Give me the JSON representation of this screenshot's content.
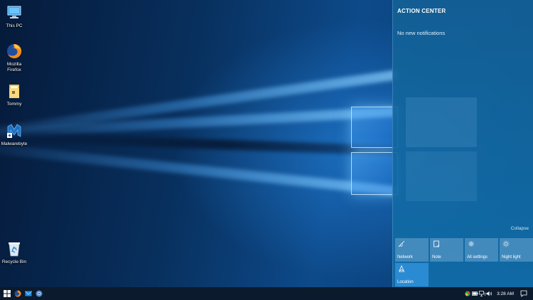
{
  "desktop": {
    "icons": [
      {
        "label": "This PC",
        "icon": "computer-icon"
      },
      {
        "label": "Mozilla Firefox",
        "icon": "firefox-icon"
      },
      {
        "label": "Tommy",
        "icon": "folder-icon"
      },
      {
        "label": "Malwarebyte",
        "icon": "malwarebytes-icon"
      },
      {
        "label": "Recycle Bin",
        "icon": "recycle-bin-icon"
      }
    ]
  },
  "action_center": {
    "title": "ACTION CENTER",
    "empty_message": "No new notifications",
    "collapse_label": "Collapse",
    "quick_actions": [
      {
        "label": "Network",
        "icon": "network-icon",
        "active": false
      },
      {
        "label": "Note",
        "icon": "note-icon",
        "active": false
      },
      {
        "label": "All settings",
        "icon": "settings-gear-icon",
        "active": false
      },
      {
        "label": "Night light",
        "icon": "night-light-icon",
        "active": false
      },
      {
        "label": "Location",
        "icon": "location-icon",
        "active": true
      }
    ]
  },
  "taskbar": {
    "pinned": [
      "windows-start-icon",
      "firefox-icon",
      "mail-icon",
      "chrome-icon"
    ],
    "tray_icons": [
      "app-tray-icon",
      "battery-icon",
      "network-tray-icon",
      "volume-icon"
    ],
    "clock": "3:28 AM",
    "notification_icon": "action-center-icon"
  },
  "colors": {
    "action_center_bg": "#13609a",
    "tile_bg": "#6ea5d2",
    "tile_active_bg": "#2b8bd2",
    "taskbar_bg": "#0b1a2c"
  }
}
